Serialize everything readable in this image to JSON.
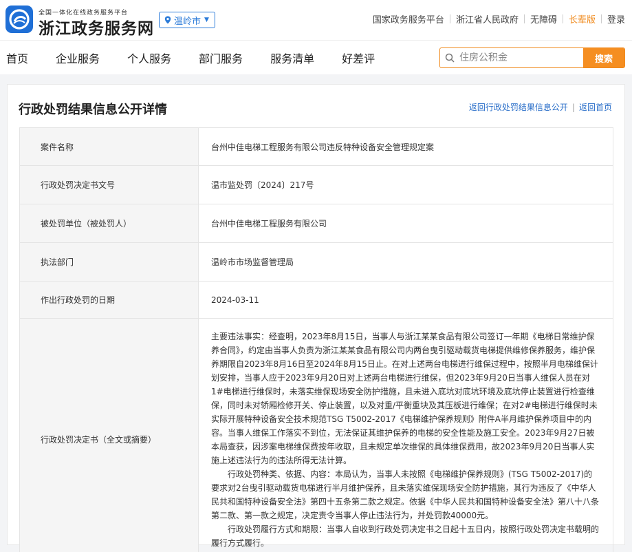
{
  "header": {
    "site_subtitle": "全国一体化在线政务服务平台",
    "site_name": "浙江政务服务网",
    "region": "温岭市",
    "links": [
      "国家政务服务平台",
      "浙江省人民政府",
      "无障碍",
      "长辈版",
      "登录"
    ]
  },
  "nav": {
    "items": [
      "首页",
      "企业服务",
      "个人服务",
      "部门服务",
      "服务清单",
      "好差评"
    ],
    "search_placeholder": "住房公积金",
    "search_button": "搜索"
  },
  "page": {
    "title": "行政处罚结果信息公开详情",
    "back_link": "返回行政处罚结果信息公开",
    "home_link": "返回首页"
  },
  "details": {
    "rows": [
      {
        "label": "案件名称",
        "value": "台州中佳电梯工程服务有限公司违反特种设备安全管理规定案"
      },
      {
        "label": "行政处罚决定书文号",
        "value": "温市监处罚〔2024〕217号"
      },
      {
        "label": "被处罚单位（被处罚人）",
        "value": "台州中佳电梯工程服务有限公司"
      },
      {
        "label": "执法部门",
        "value": "温岭市市场监督管理局"
      },
      {
        "label": "作出行政处罚的日期",
        "value": "2024-03-11"
      }
    ],
    "decision_label": "行政处罚决定书（全文或摘要）",
    "decision_paragraphs": [
      "主要违法事实：经查明，2023年8月15日，当事人与浙江某某食品有限公司签订一年期《电梯日常维护保养合同》，约定由当事人负责为浙江某某食品有限公司内两台曳引驱动载货电梯提供维修保养服务，维护保养期限自2023年8月16日至2024年8月15日止。在对上述两台电梯进行维保过程中，按照半月电梯维保计划安排，当事人应于2023年9月20日对上述两台电梯进行维保，但2023年9月20日当事人维保人员在对1#电梯进行维保时，未落实维保现场安全防护措施，且未进入底坑对底坑环境及底坑停止装置进行检查维保，同时未对轿厢检修开关、停止装置，以及对重/平衡重块及其压板进行维保；在对2#电梯进行维保时未实际开展特种设备安全技术规范TSG T5002-2017《电梯维护保养规则》附件A半月维护保养项目中的内容。当事人维保工作落实不到位，无法保证其维护保养的电梯的安全性能及施工安全。2023年9月27日被本局查获，因涉案电梯维保费按年收取，且未规定单次维保的具体维保费用，故2023年9月20日当事人实施上述违法行为的违法所得无法计算。",
      "行政处罚种类、依据、内容：本局认为，当事人未按照《电梯维护保养规则》(TSG T5002-2017)的要求对2台曳引驱动载货电梯进行半月维护保养，且未落实维保现场安全防护措施，其行为违反了《中华人民共和国特种设备安全法》第四十五条第二款之规定。依据《中华人民共和国特种设备安全法》第八十八条第二款、第一款之规定，决定责令当事人停止违法行为，并处罚款40000元。",
      "行政处罚履行方式和期限：当事人自收到行政处罚决定书之日起十五日内，按照行政处罚决定书载明的履行方式履行。"
    ]
  }
}
